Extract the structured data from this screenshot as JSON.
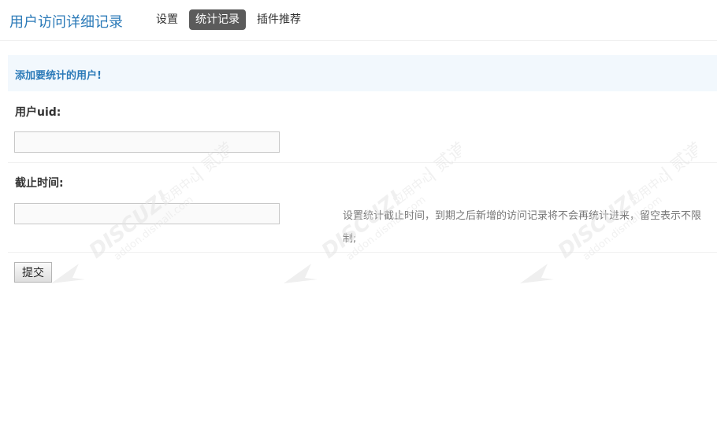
{
  "header": {
    "title": "用户访问详细记录",
    "tabs": [
      {
        "label": "设置",
        "active": false
      },
      {
        "label": "统计记录",
        "active": true
      },
      {
        "label": "插件推荐",
        "active": false
      }
    ]
  },
  "notice": {
    "text": "添加要统计的用户!"
  },
  "form": {
    "uid_label": "用户uid:",
    "uid_value": "",
    "cutoff_label": "截止时间:",
    "cutoff_value": "",
    "hint_text": "设置统计截止时间，到期之后新增的访问记录将不会再统计进来，留空表示不限制;",
    "submit_label": "提交"
  },
  "watermark": {
    "brand_line": "DISCUZ!应用中心",
    "brand_chinese": "贰道",
    "url_line": "addon.dismall.com"
  },
  "colors": {
    "accent": "#2b7ab8",
    "notice_bg": "#f2f8fd",
    "active_tab_bg": "#5b5b5b"
  }
}
